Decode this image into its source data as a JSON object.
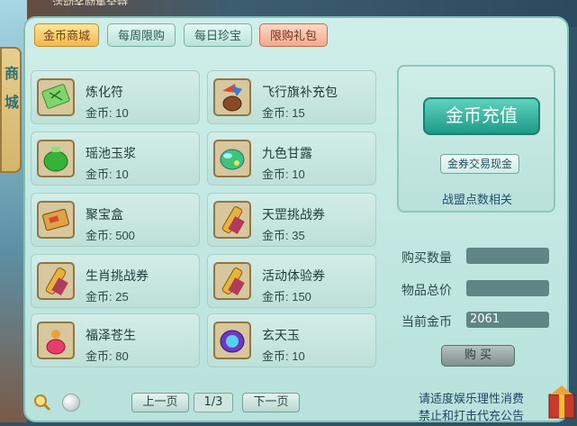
{
  "top_bar_text": "活动奖励集全特",
  "side_nav": [
    "商",
    "城"
  ],
  "tabs": [
    {
      "label": "金币商城",
      "active": true
    },
    {
      "label": "每周限购",
      "active": false
    },
    {
      "label": "每日珍宝",
      "active": false
    },
    {
      "label": "限购礼包",
      "active": false
    }
  ],
  "items": [
    {
      "name": "炼化符",
      "price": "金币: 10",
      "icon": "talisman-icon"
    },
    {
      "name": "飞行旗补充包",
      "price": "金币: 15",
      "icon": "flag-bag-icon"
    },
    {
      "name": "瑶池玉浆",
      "price": "金币: 10",
      "icon": "jade-pot-icon"
    },
    {
      "name": "九色甘露",
      "price": "金币: 10",
      "icon": "dew-gem-icon"
    },
    {
      "name": "聚宝盒",
      "price": "金币: 500",
      "icon": "treasure-box-icon"
    },
    {
      "name": "天罡挑战券",
      "price": "金币: 35",
      "icon": "scroll-icon"
    },
    {
      "name": "生肖挑战券",
      "price": "金币: 25",
      "icon": "scroll-icon"
    },
    {
      "name": "活动体验券",
      "price": "金币: 150",
      "icon": "scroll-icon"
    },
    {
      "name": "福泽苍生",
      "price": "金币: 80",
      "icon": "gourd-icon"
    },
    {
      "name": "玄天玉",
      "price": "金币: 10",
      "icon": "jade-icon"
    }
  ],
  "right": {
    "recharge_label": "金币充值",
    "exchange_label": "金券交易现金",
    "alliance_label": "战盟点数相关"
  },
  "form": {
    "quantity_label": "购买数量",
    "quantity_value": "",
    "total_label": "物品总价",
    "total_value": "",
    "current_label": "当前金币",
    "current_value": "2061",
    "buy_label": "购 买"
  },
  "pager": {
    "prev_label": "上一页",
    "page": "1/3",
    "next_label": "下一页"
  },
  "notice": [
    "请适度娱乐理性消费",
    "禁止和打击代充公告"
  ],
  "colors": {
    "panel": "#c6e8e2",
    "active_tab": "#f1b84c",
    "recharge_button": "#1f9a88",
    "field": "#5f8685"
  }
}
